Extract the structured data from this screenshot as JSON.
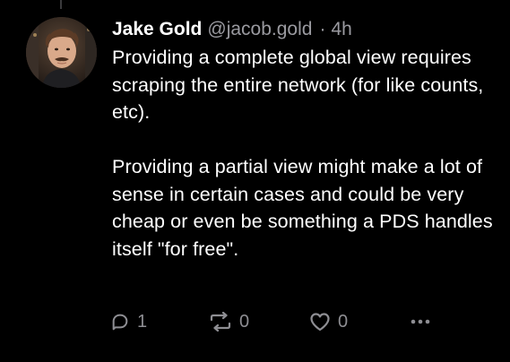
{
  "post": {
    "author": {
      "display_name": "Jake Gold",
      "handle": "@jacob.gold",
      "separator": "·",
      "time": "4h"
    },
    "paragraphs": [
      "Providing a complete global view requires scraping the entire network (for like counts, etc).",
      "Providing a partial view might make a lot of sense in certain cases and could be very cheap or even be something a PDS handles itself \"for free\"."
    ],
    "actions": {
      "reply_count": "1",
      "repost_count": "0",
      "like_count": "0"
    }
  },
  "icons": {
    "reply": "reply-icon",
    "repost": "repost-icon",
    "like": "heart-icon",
    "more": "more-dots-icon"
  },
  "colors": {
    "background": "#000000",
    "text": "#ffffff",
    "muted": "#9a9aa0",
    "icon": "#8e8e93"
  }
}
